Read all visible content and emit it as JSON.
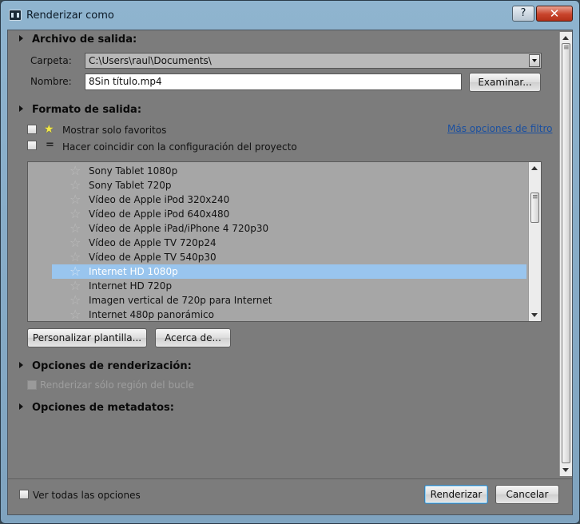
{
  "window": {
    "title": "Renderizar como",
    "help_label": "?",
    "close_label": "✕"
  },
  "output_file": {
    "header": "Archivo de salida:",
    "folder_label": "Carpeta:",
    "folder_value": "C:\\Users\\raul\\Documents\\",
    "name_label": "Nombre:",
    "name_value": "8Sin título.mp4",
    "browse_button": "Examinar..."
  },
  "output_format": {
    "header": "Formato de salida:",
    "favorites_only": "Mostrar solo favoritos",
    "match_project": "Hacer coincidir con la configuración del proyecto",
    "more_filters_link": "Más opciones de filtro",
    "templates": [
      {
        "label": "Sony Tablet 1080p",
        "selected": false
      },
      {
        "label": "Sony Tablet 720p",
        "selected": false
      },
      {
        "label": "Vídeo de Apple iPod 320x240",
        "selected": false
      },
      {
        "label": "Vídeo de Apple iPod 640x480",
        "selected": false
      },
      {
        "label": "Vídeo de Apple iPad/iPhone 4 720p30",
        "selected": false
      },
      {
        "label": "Vídeo de Apple TV 720p24",
        "selected": false
      },
      {
        "label": "Vídeo de Apple TV 540p30",
        "selected": false
      },
      {
        "label": "Internet HD 1080p",
        "selected": true
      },
      {
        "label": "Internet HD 720p",
        "selected": false
      },
      {
        "label": "Imagen vertical de 720p para Internet",
        "selected": false
      },
      {
        "label": "Internet 480p panorámico",
        "selected": false
      }
    ],
    "customize_button": "Personalizar plantilla...",
    "about_button": "Acerca de..."
  },
  "render_options": {
    "header": "Opciones de renderización:",
    "loop_region_only": "Renderizar sólo región del bucle"
  },
  "metadata_options": {
    "header": "Opciones de metadatos:"
  },
  "footer": {
    "show_all_options": "Ver todas las opciones",
    "render_button": "Renderizar",
    "cancel_button": "Cancelar"
  },
  "icons": {
    "favorite_star": "★",
    "template_star": "☆",
    "match_project": "="
  },
  "colors": {
    "selection": "#99c5ee",
    "link": "#1a4fa0",
    "favorite_star": "#f2e94a"
  }
}
